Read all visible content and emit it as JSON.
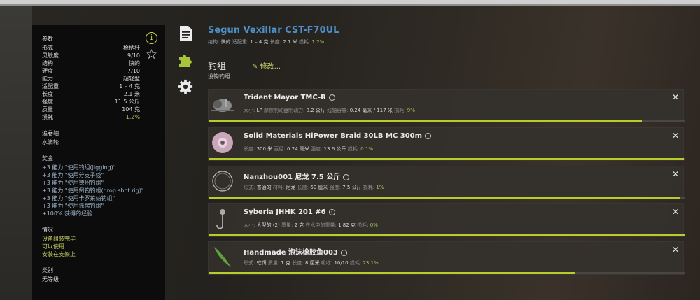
{
  "stats": {
    "params_header": "参数",
    "rows": [
      {
        "label": "形式",
        "value": "枪柄杆"
      },
      {
        "label": "灵敏度",
        "value": "9/10"
      },
      {
        "label": "结构",
        "value": "快的"
      },
      {
        "label": "硬度",
        "value": "7/10"
      },
      {
        "label": "能力",
        "value": "超轻型"
      },
      {
        "label": "适配重",
        "value": "1 – 4 克"
      },
      {
        "label": "长度",
        "value": "2.1 米"
      },
      {
        "label": "强度",
        "value": "11.5 公斤"
      },
      {
        "label": "质量",
        "value": "104 克"
      },
      {
        "label": "损耗",
        "value": "1.2%"
      }
    ],
    "reel_header": "追卷轴",
    "reel_value": "水滴轮",
    "bonus_header": "奖金",
    "bonuses": [
      "+3 能力 \"使用钓组(jigging)\"",
      "+3 能力 \"使用分支子线\"",
      "+3 能力 \"使用德州钓组\"",
      "+3 能力 \"使用倒钓钓组(drop shot rig)\"",
      "+3 能力 \"使用卡罗莱纳钓组\"",
      "+3 能力 \"使用摇摆钓组\"",
      "+100% 获得的经验"
    ],
    "status_header": "情况",
    "status_lines": [
      "设备组装完毕",
      "可以使用",
      "安装在支架上"
    ],
    "category_header": "类别",
    "category_value": "无等级"
  },
  "rod": {
    "name": "Segun Vexillar CST-F70UL",
    "structure_label": "结构:",
    "structure_value": "快的",
    "fitweight_label": "适配重:",
    "fitweight_value": "1 – 4 克",
    "length_label": "长度:",
    "length_value": "2.1 米",
    "wear_label": "损耗:",
    "wear_value": "1.2%"
  },
  "gear": {
    "title": "钓组",
    "subtitle": "没钩钓组",
    "modify_label": "修改..."
  },
  "cards": [
    {
      "name": "Trident Mayor TMC-R",
      "meta": [
        {
          "label": "大小:",
          "value": "LP"
        },
        {
          "label": "摩擦制动器制动力:",
          "value": "8.2 公斤"
        },
        {
          "label": "线轴容量:",
          "value": "0.24 毫米 / 117 米"
        },
        {
          "label": "损耗:",
          "value": "9%",
          "green": true
        }
      ],
      "progress": 0.91
    },
    {
      "name": "Solid Materials HiPower Braid 30LB MC 300m",
      "meta": [
        {
          "label": "长度:",
          "value": "300 米"
        },
        {
          "label": "直径:",
          "value": "0.24 毫米"
        },
        {
          "label": "强度:",
          "value": "13.6 公斤"
        },
        {
          "label": "损耗:",
          "value": "0.1%",
          "green": true
        }
      ],
      "progress": 0.999
    },
    {
      "name": "Nanzhou001 尼龙 7.5 公斤",
      "meta": [
        {
          "label": "形式:",
          "value": "普通的"
        },
        {
          "label": "材料:",
          "value": "尼龙"
        },
        {
          "label": "长度:",
          "value": "60 厘米"
        },
        {
          "label": "强度:",
          "value": "7.5 公斤"
        },
        {
          "label": "损耗:",
          "value": "1%",
          "green": true
        }
      ],
      "progress": 0.99
    },
    {
      "name": "Syberia JHHK 201 #6",
      "meta": [
        {
          "label": "大小:",
          "value": "大型的 (2)"
        },
        {
          "label": "质量:",
          "value": "2 克"
        },
        {
          "label": "在水中的重量:",
          "value": "1.82 克"
        },
        {
          "label": "损耗:",
          "value": "0%",
          "green": true
        }
      ],
      "progress": 1.0
    },
    {
      "name": "Handmade 泡沫橡胶鱼003",
      "meta": [
        {
          "label": "形式:",
          "value": "软饵"
        },
        {
          "label": "质量:",
          "value": "1 克"
        },
        {
          "label": "长度:",
          "value": "8 厘米"
        },
        {
          "label": "吸收:",
          "value": "10/10"
        },
        {
          "label": "损耗:",
          "value": "23.1%",
          "green": true
        }
      ],
      "progress": 0.77
    }
  ],
  "icons": {
    "info": "info-icon",
    "star": "star-icon",
    "document": "document-icon",
    "puzzle": "puzzle-icon",
    "settings": "gear-icon",
    "close": "close-icon",
    "edit": "edit-icon"
  },
  "colors": {
    "accent": "#b8cc2c",
    "rod_title": "#4e90c7",
    "wear_green": "#a9c55a"
  }
}
